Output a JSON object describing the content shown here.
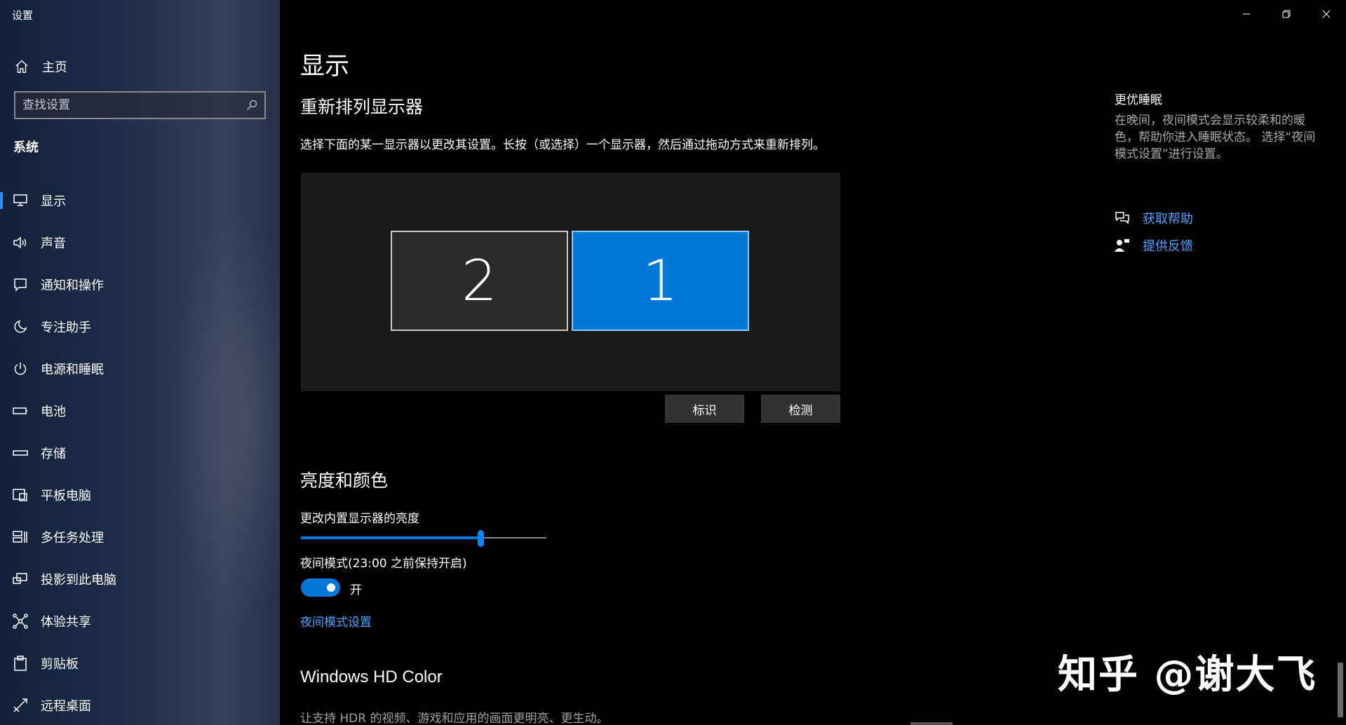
{
  "window": {
    "title": "设置"
  },
  "sidebar": {
    "home_label": "主页",
    "search_placeholder": "查找设置",
    "section_label": "系统",
    "items": [
      {
        "label": "显示",
        "icon": "monitor-icon",
        "active": true
      },
      {
        "label": "声音",
        "icon": "speaker-icon"
      },
      {
        "label": "通知和操作",
        "icon": "notification-icon"
      },
      {
        "label": "专注助手",
        "icon": "moon-icon"
      },
      {
        "label": "电源和睡眠",
        "icon": "power-icon"
      },
      {
        "label": "电池",
        "icon": "battery-icon"
      },
      {
        "label": "存储",
        "icon": "storage-icon"
      },
      {
        "label": "平板电脑",
        "icon": "tablet-icon"
      },
      {
        "label": "多任务处理",
        "icon": "multitask-icon"
      },
      {
        "label": "投影到此电脑",
        "icon": "project-icon"
      },
      {
        "label": "体验共享",
        "icon": "share-icon"
      },
      {
        "label": "剪贴板",
        "icon": "clipboard-icon"
      },
      {
        "label": "远程桌面",
        "icon": "remote-desktop-icon"
      }
    ]
  },
  "main": {
    "page_title": "显示",
    "arrange": {
      "heading": "重新排列显示器",
      "description": "选择下面的某一显示器以更改其设置。长按（或选择）一个显示器，然后通过拖动方式来重新排列。",
      "monitors": [
        {
          "number": "2",
          "selected": false
        },
        {
          "number": "1",
          "selected": true
        }
      ],
      "identify_label": "标识",
      "detect_label": "检测"
    },
    "brightness": {
      "heading": "亮度和颜色",
      "slider_label": "更改内置显示器的亮度",
      "slider_value": 0.73,
      "night_mode_label": "夜间模式(23:00 之前保持开启)",
      "night_mode_state": "开",
      "night_mode_on": true,
      "night_mode_link": "夜间模式设置"
    },
    "hdr": {
      "heading": "Windows HD Color",
      "description": "让支持 HDR 的视频、游戏和应用的画面更明亮、更生动。"
    }
  },
  "aside": {
    "title": "更优睡眠",
    "description": "在晚间，夜间模式会显示较柔和的暖色，帮助你进入睡眠状态。 选择“夜间模式设置”进行设置。",
    "links": [
      {
        "label": "获取帮助",
        "icon": "help-chat-icon"
      },
      {
        "label": "提供反馈",
        "icon": "feedback-icon"
      }
    ]
  },
  "watermark": "知乎 @谢大飞",
  "colors": {
    "accent": "#0078d7",
    "link": "#4aa2ff",
    "background": "#000000"
  }
}
